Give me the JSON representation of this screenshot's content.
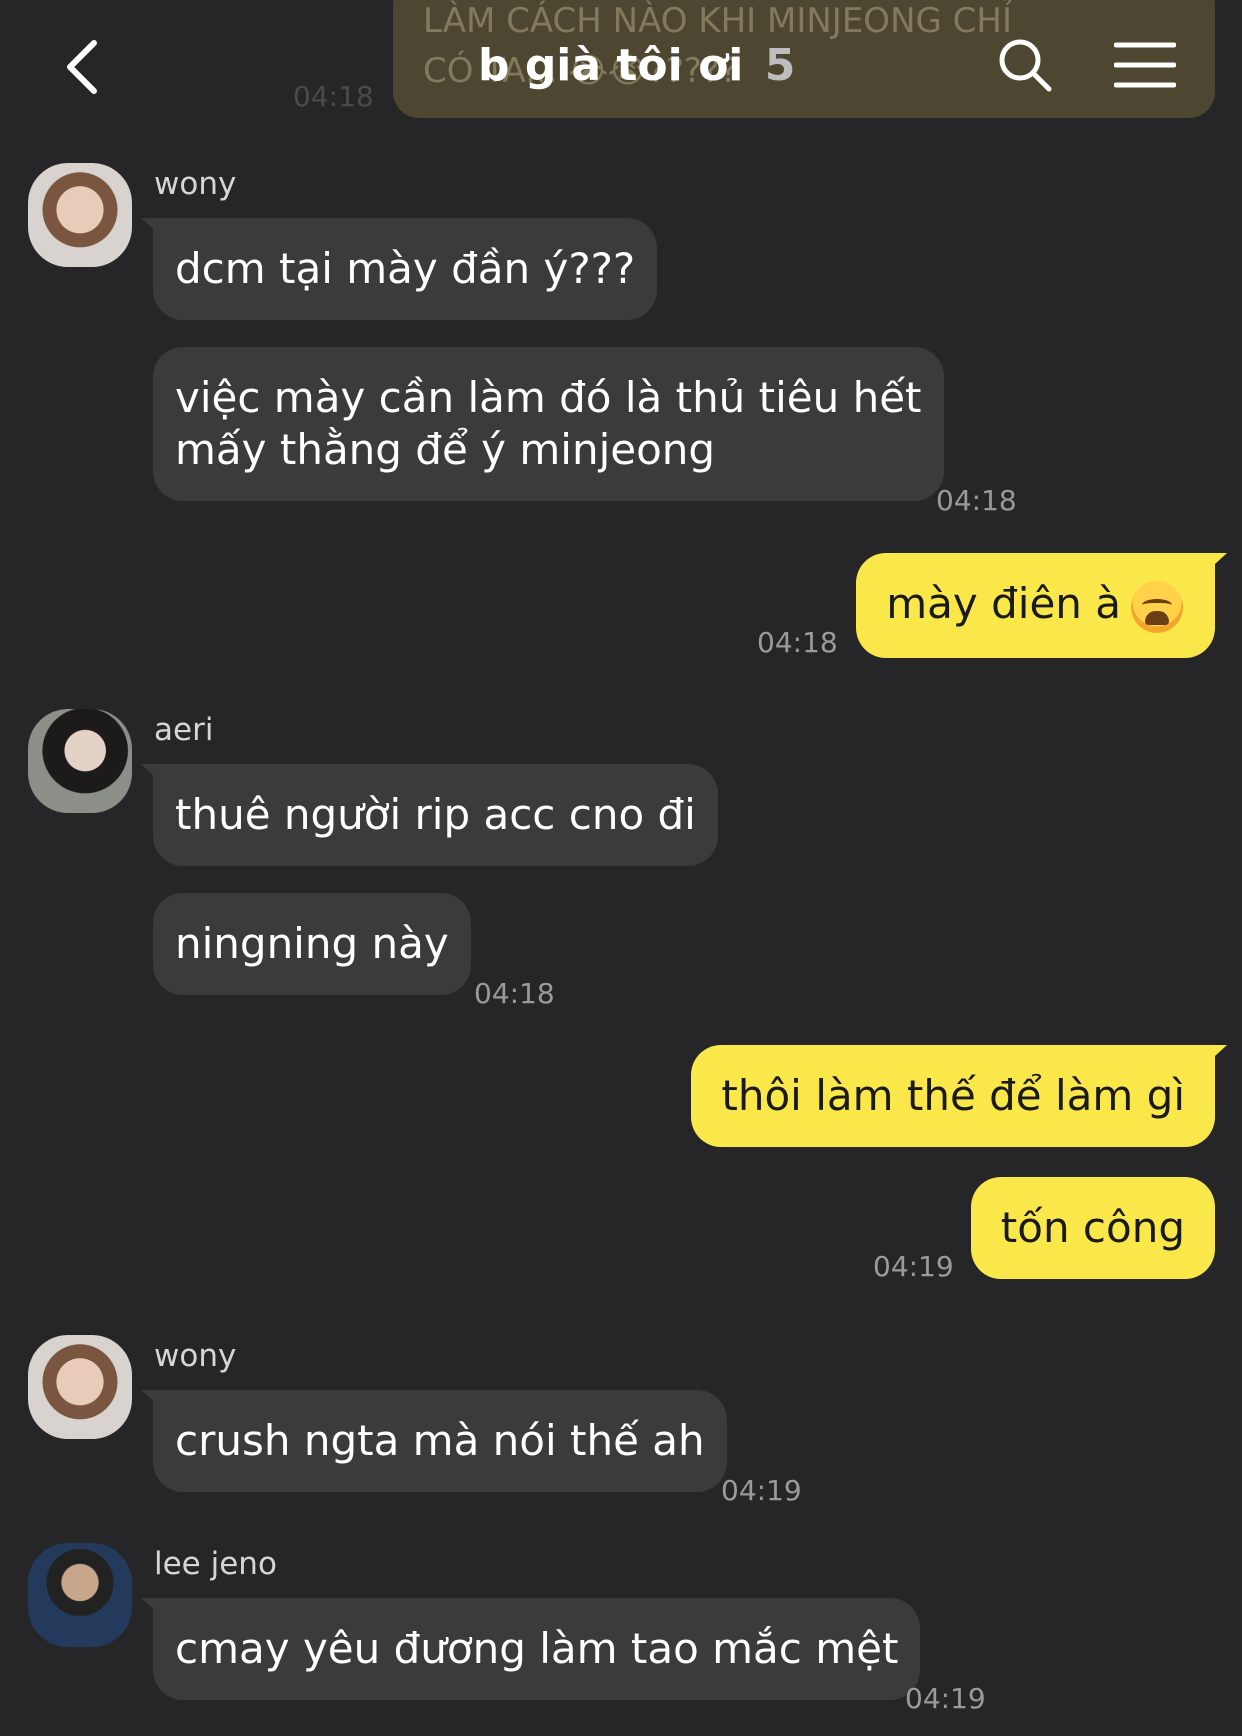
{
  "ghost": {
    "line1": "LÀM CÁCH NÀO KHI MINJEONG CHỈ",
    "line2": "CÓ TA... 😭😭?????",
    "time": "04:18"
  },
  "header": {
    "title": "b già tôi ơi",
    "member_count": "5",
    "back_icon": "chevron-left-icon",
    "search_icon": "search-icon",
    "menu_icon": "hamburger-menu-icon"
  },
  "messages": [
    {
      "sender": "wony",
      "text": "dcm tại mày đần ý???"
    },
    {
      "text_line1": "việc mày cần làm đó là thủ tiêu hết",
      "text_line2": "mấy thằng để ý minjeong",
      "time": "04:18"
    },
    {
      "text": "mày điên à",
      "time": "04:18",
      "emoji": "loudly-crying-face"
    },
    {
      "sender": "aeri",
      "text": "thuê người rip acc cno đi"
    },
    {
      "text": "ningning này",
      "time": "04:18"
    },
    {
      "text": "thôi làm thế để làm gì"
    },
    {
      "text": "tốn công",
      "time": "04:19"
    },
    {
      "sender": "wony",
      "text": "crush ngta mà nói thế ah",
      "time": "04:19"
    },
    {
      "sender": "lee jeno",
      "text": "cmay yêu đương làm tao mắc mệt",
      "time": "04:19"
    }
  ],
  "colors": {
    "background": "#262628",
    "incoming_bubble": "#3b3b3d",
    "outgoing_bubble": "#fae84b"
  }
}
